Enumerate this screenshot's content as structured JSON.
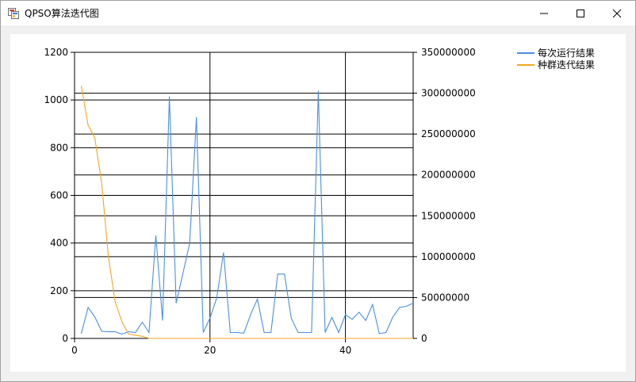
{
  "window": {
    "title": "QPSO算法迭代图",
    "controls": {
      "minimize": "minimize-icon",
      "maximize": "maximize-icon",
      "close": "close-icon"
    }
  },
  "chart_data": {
    "type": "line",
    "x": [
      1,
      2,
      3,
      4,
      5,
      6,
      7,
      8,
      9,
      10,
      11,
      12,
      13,
      14,
      15,
      16,
      17,
      18,
      19,
      20,
      21,
      22,
      23,
      24,
      25,
      26,
      27,
      28,
      29,
      30,
      31,
      32,
      33,
      34,
      35,
      36,
      37,
      38,
      39,
      40,
      41,
      42,
      43,
      44,
      45,
      46,
      47,
      48,
      49,
      50
    ],
    "series": [
      {
        "name": "每次运行结果",
        "axis": "left",
        "color": "#4a90e2",
        "values": [
          20,
          130,
          90,
          30,
          28,
          28,
          18,
          28,
          25,
          68,
          25,
          432,
          75,
          1015,
          148,
          272,
          400,
          928,
          25,
          85,
          170,
          360,
          25,
          25,
          22,
          100,
          165,
          25,
          25,
          270,
          270,
          85,
          25,
          25,
          25,
          1038,
          25,
          88,
          25,
          100,
          80,
          110,
          75,
          142,
          20,
          25,
          90,
          130,
          135,
          148
        ]
      },
      {
        "name": "种群迭代结果",
        "axis": "right",
        "color": "#f5a623",
        "values": [
          309000000,
          261000000,
          245000000,
          190000000,
          100000000,
          45000000,
          20000000,
          5000000,
          4000000,
          2500000,
          0,
          0,
          0,
          0,
          0,
          0,
          0,
          0,
          0,
          0,
          0,
          0,
          0,
          0,
          0,
          0,
          0,
          0,
          0,
          0,
          0,
          0,
          0,
          0,
          0,
          0,
          0,
          0,
          0,
          0,
          0,
          0,
          0,
          0,
          0,
          0,
          0,
          0,
          0,
          0
        ]
      }
    ],
    "xlim": [
      0,
      50
    ],
    "y_left": {
      "lim": [
        0,
        1200
      ],
      "ticks": [
        0,
        200,
        400,
        600,
        800,
        1000,
        1200
      ],
      "tick_labels": [
        "0",
        "200",
        "400",
        "600",
        "800",
        "1000",
        "1200"
      ]
    },
    "y_right": {
      "lim": [
        0,
        350000000
      ],
      "ticks": [
        0,
        50000000,
        100000000,
        150000000,
        200000000,
        250000000,
        300000000,
        350000000
      ],
      "tick_labels": [
        "0",
        "50000000",
        "100000000",
        "150000000",
        "200000000",
        "250000000",
        "300000000",
        "350000000"
      ]
    },
    "x_ticks": [
      0,
      20,
      40
    ],
    "x_tick_labels": [
      "0",
      "20",
      "40"
    ],
    "x_gridlines": [
      0,
      20,
      40,
      50
    ],
    "grid": true,
    "legend": "top-right"
  }
}
